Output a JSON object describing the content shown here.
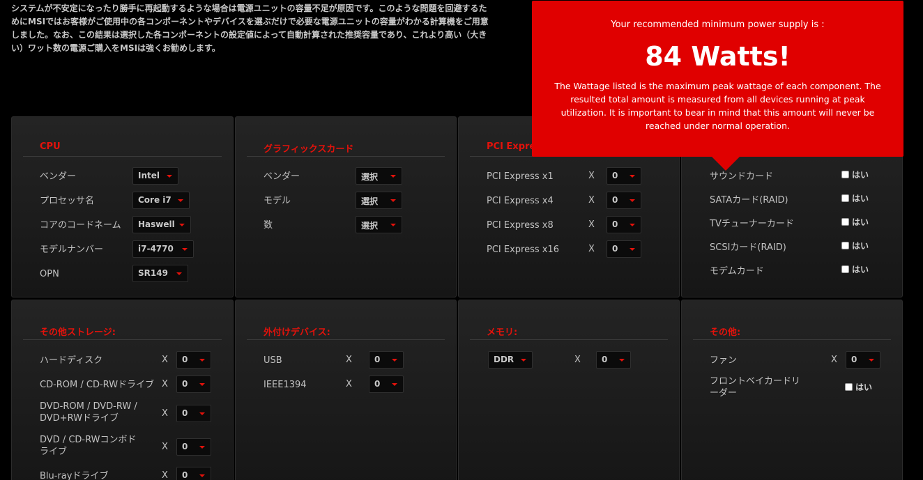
{
  "intro": "システムが不安定になったり勝手に再起動するような場合は電源ユニットの容量不足が原因です。このような問題を回避するためにMSIではお客様がご使用中の各コンポーネントやデバイスを選ぶだけで必要な電源ユニットの容量がわかる計算機をご用意しました。なお、この結果は選択した各コンポーネントの設定値によって自動計算された推奨容量であり、これより高い（大きい）ワット数の電源ご購入をMSIは強くお勧めします。",
  "popup": {
    "pre": "Your recommended minimum power supply is :",
    "watts": "84 Watts!",
    "desc": "The Wattage listed is the maximum peak wattage of each component. The resulted total amount is measured from all devices running at peak utilization. It is important to bear in mind that this amount will never be reached under normal operation."
  },
  "x": "X",
  "yes": "はい",
  "cpu": {
    "title": "CPU",
    "rows": [
      {
        "label": "ベンダー",
        "value": "Intel"
      },
      {
        "label": "プロセッサ名",
        "value": "Core i7"
      },
      {
        "label": "コアのコードネーム",
        "value": "Haswell"
      },
      {
        "label": "モデルナンバー",
        "value": "i7-4770"
      },
      {
        "label": "OPN",
        "value": "SR149"
      }
    ]
  },
  "gpu": {
    "title": "グラフィックスカード",
    "rows": [
      {
        "label": "ベンダー",
        "value": "選択"
      },
      {
        "label": "モデル",
        "value": "選択"
      },
      {
        "label": "数",
        "value": "選択"
      }
    ]
  },
  "pci": {
    "title": "PCI Express",
    "rows": [
      {
        "label": "PCI Express x1",
        "value": "0"
      },
      {
        "label": "PCI Express x4",
        "value": "0"
      },
      {
        "label": "PCI Express x8",
        "value": "0"
      },
      {
        "label": "PCI Express x16",
        "value": "0"
      }
    ]
  },
  "cards": {
    "rows": [
      {
        "label": "サウンドカード"
      },
      {
        "label": "SATAカード(RAID)"
      },
      {
        "label": "TVチューナーカード"
      },
      {
        "label": "SCSIカード(RAID)"
      },
      {
        "label": "モデムカード"
      }
    ]
  },
  "storage": {
    "title": "その他ストレージ:",
    "rows": [
      {
        "label": "ハードディスク",
        "value": "0"
      },
      {
        "label": "CD-ROM / CD-RWドライブ",
        "value": "0"
      },
      {
        "label": "DVD-ROM / DVD-RW / DVD+RWドライブ",
        "value": "0"
      },
      {
        "label": "DVD / CD-RWコンボドライブ",
        "value": "0"
      },
      {
        "label": "Blu-rayドライブ",
        "value": "0"
      }
    ]
  },
  "external": {
    "title": "外付けデバイス:",
    "rows": [
      {
        "label": "USB",
        "value": "0"
      },
      {
        "label": "IEEE1394",
        "value": "0"
      }
    ]
  },
  "memory": {
    "title": "メモリ:",
    "type": "DDR",
    "value": "0"
  },
  "other": {
    "title": "その他:",
    "fan_label": "ファン",
    "fan_value": "0",
    "reader_label": "フロントベイカードリーダー"
  }
}
